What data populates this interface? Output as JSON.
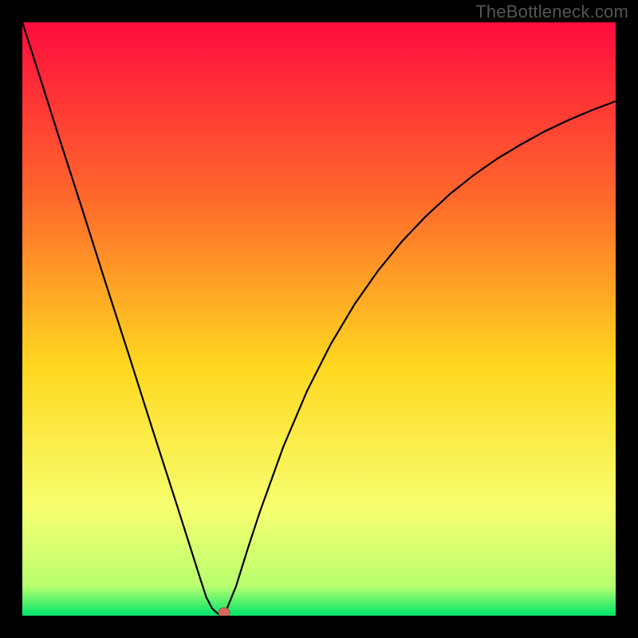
{
  "source_label": "TheBottleneck.com",
  "colors": {
    "frame": "#000000",
    "gradient_top": "#ff0c3e",
    "gradient_mid1": "#ff6a2b",
    "gradient_mid2": "#ffd81f",
    "gradient_mid3": "#f7ff70",
    "gradient_bottom": "#00e56a",
    "curve": "#000000",
    "marker_fill": "#d46a5f",
    "marker_stroke": "#b24b42"
  },
  "chart_data": {
    "type": "line",
    "title": "",
    "xlabel": "",
    "ylabel": "",
    "xlim": [
      0,
      100
    ],
    "ylim": [
      0,
      100
    ],
    "series": [
      {
        "name": "bottleneck-curve",
        "x": [
          0,
          2,
          4,
          6,
          8,
          10,
          12,
          14,
          16,
          18,
          20,
          22,
          24,
          26,
          28,
          30,
          31,
          32,
          33,
          34,
          36,
          38,
          40,
          44,
          48,
          52,
          56,
          60,
          64,
          68,
          72,
          76,
          80,
          84,
          88,
          92,
          96,
          100
        ],
        "values": [
          100,
          93.8,
          87.5,
          81.2,
          75,
          68.8,
          62.5,
          56.2,
          50,
          43.8,
          37.5,
          31.2,
          25,
          18.8,
          12.5,
          6.2,
          3.1,
          1.2,
          0.3,
          0,
          4.9,
          11.3,
          17.4,
          28.5,
          37.9,
          45.8,
          52.5,
          58.2,
          63.1,
          67.3,
          71.0,
          74.2,
          77.0,
          79.4,
          81.6,
          83.5,
          85.2,
          86.7
        ]
      }
    ],
    "marker": {
      "x": 34,
      "y": 0
    },
    "gradient_stops": [
      {
        "offset": 0.0,
        "color": "#ff0c3e"
      },
      {
        "offset": 0.3,
        "color": "#ff6a2b"
      },
      {
        "offset": 0.58,
        "color": "#ffd81f"
      },
      {
        "offset": 0.82,
        "color": "#f7ff70"
      },
      {
        "offset": 0.95,
        "color": "#b8ff6e"
      },
      {
        "offset": 1.0,
        "color": "#00e56a"
      }
    ]
  }
}
